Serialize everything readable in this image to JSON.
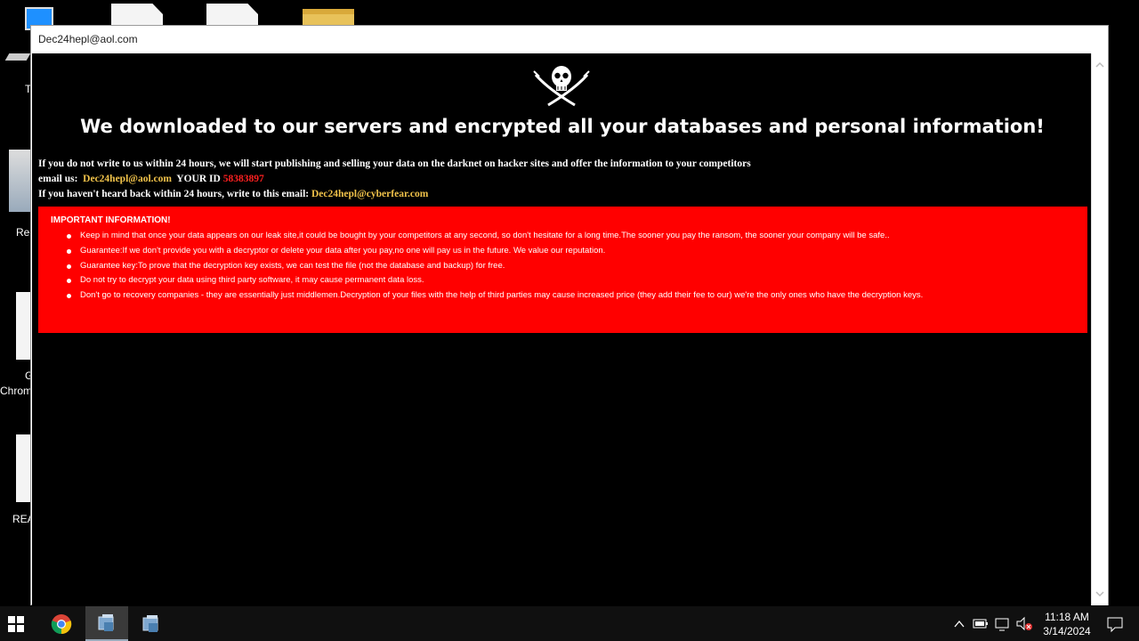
{
  "desktop": {
    "icons": [
      {
        "label": "T"
      },
      {
        "label": "Rec"
      },
      {
        "label": "G"
      },
      {
        "label": "Chrom"
      },
      {
        "label": "REA"
      }
    ]
  },
  "window": {
    "title": "Dec24hepl@aol.com"
  },
  "note": {
    "headline": "We downloaded to our servers and encrypted all your databases and personal information!",
    "line1": "If you do not write to us within 24 hours, we will start publishing and selling your data on the darknet on hacker sites and offer the information to your competitors",
    "email_label": "email us:",
    "email": "Dec24hepl@aol.com",
    "id_label": "YOUR ID",
    "id_value": "58383897",
    "line3_prefix": "If you haven't heard back within 24 hours, write to this email:",
    "alt_email": "Dec24hepl@cyberfear.com",
    "important_title": "IMPORTANT INFORMATION!",
    "items": [
      "Keep in mind that once your data appears on our leak site,it could be bought by your competitors at any second, so don't hesitate for a long time.The sooner you pay the ransom, the sooner your company will be safe..",
      "",
      "Guarantee:If we don't provide you with a decryptor or delete your data after you pay,no one will pay us in the future. We value our reputation.",
      "Guarantee key:To prove that the decryption key exists, we can test the file (not the database and backup) for free.",
      "Do not try to decrypt your data using third party software, it may cause permanent data loss.",
      "Don't go to recovery companies - they are essentially just middlemen.Decryption of your files with the help of third parties may cause increased price (they add their fee to our) we're the only ones who have the decryption keys."
    ]
  },
  "taskbar": {
    "time": "11:18 AM",
    "date": "3/14/2024"
  },
  "colors": {
    "accent_red": "#ff0000",
    "email_yellow": "#f0c24a"
  }
}
